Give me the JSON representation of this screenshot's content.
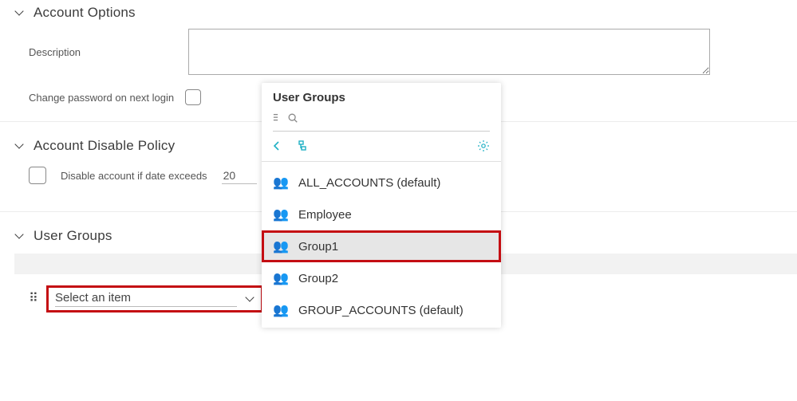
{
  "sections": {
    "account_options": {
      "title": "Account Options",
      "description_label": "Description",
      "description_value": "",
      "change_password_label": "Change password on next login"
    },
    "account_disable_policy": {
      "title": "Account Disable Policy",
      "disable_label": "Disable account if date exceeds",
      "date_value": "20"
    },
    "user_groups": {
      "title": "User Groups",
      "select_placeholder": "Select an item"
    }
  },
  "popup": {
    "title": "User Groups",
    "items": [
      {
        "label": "ALL_ACCOUNTS (default)",
        "selected": false,
        "highlighted": false
      },
      {
        "label": "Employee",
        "selected": false,
        "highlighted": false
      },
      {
        "label": "Group1",
        "selected": true,
        "highlighted": true
      },
      {
        "label": "Group2",
        "selected": false,
        "highlighted": false
      },
      {
        "label": "GROUP_ACCOUNTS (default)",
        "selected": false,
        "highlighted": false
      }
    ]
  }
}
